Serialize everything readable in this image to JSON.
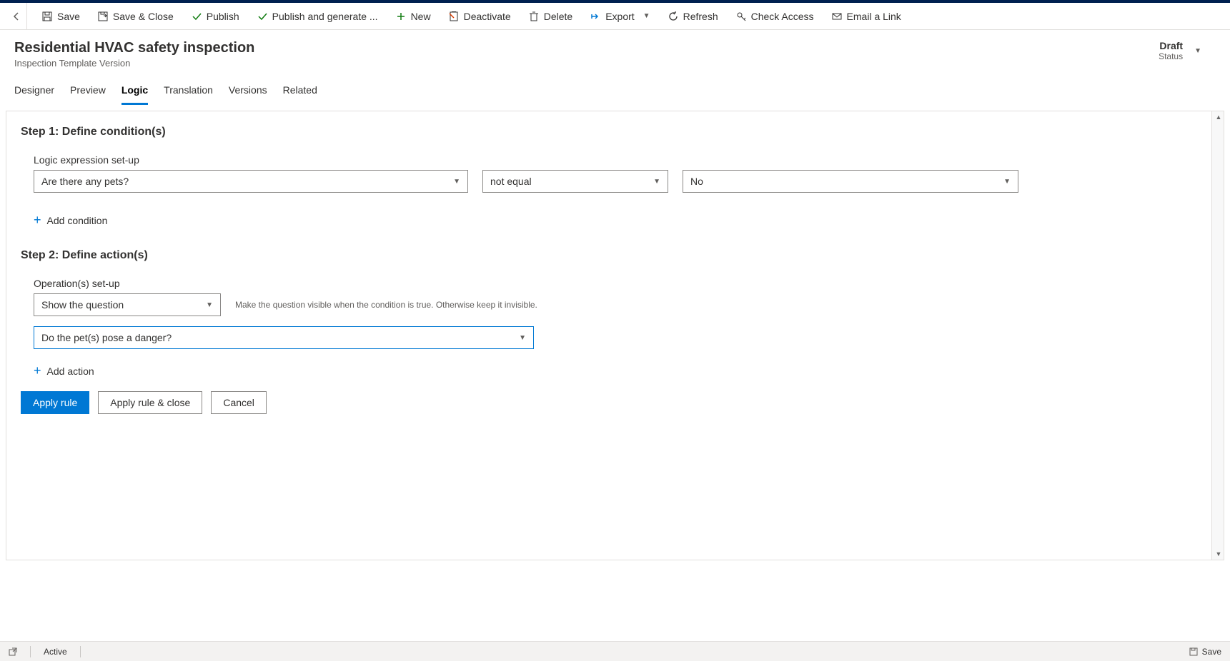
{
  "toolbar": {
    "save": "Save",
    "save_close": "Save & Close",
    "publish": "Publish",
    "publish_generate": "Publish and generate ...",
    "new": "New",
    "deactivate": "Deactivate",
    "delete": "Delete",
    "export": "Export",
    "refresh": "Refresh",
    "check_access": "Check Access",
    "email_link": "Email a Link"
  },
  "header": {
    "title": "Residential HVAC safety inspection",
    "subtitle": "Inspection Template Version",
    "status_value": "Draft",
    "status_label": "Status"
  },
  "tabs": {
    "designer": "Designer",
    "preview": "Preview",
    "logic": "Logic",
    "translation": "Translation",
    "versions": "Versions",
    "related": "Related"
  },
  "step1": {
    "heading": "Step 1: Define condition(s)",
    "label": "Logic expression set-up",
    "question": "Are there any pets?",
    "operator": "not equal",
    "value": "No",
    "add": "Add condition"
  },
  "step2": {
    "heading": "Step 2: Define action(s)",
    "label": "Operation(s) set-up",
    "operation": "Show the question",
    "help": "Make the question visible when the condition is true. Otherwise keep it invisible.",
    "target": "Do the pet(s) pose a danger?",
    "add": "Add action"
  },
  "buttons": {
    "apply": "Apply rule",
    "apply_close": "Apply rule & close",
    "cancel": "Cancel"
  },
  "footer": {
    "status": "Active",
    "save": "Save"
  }
}
